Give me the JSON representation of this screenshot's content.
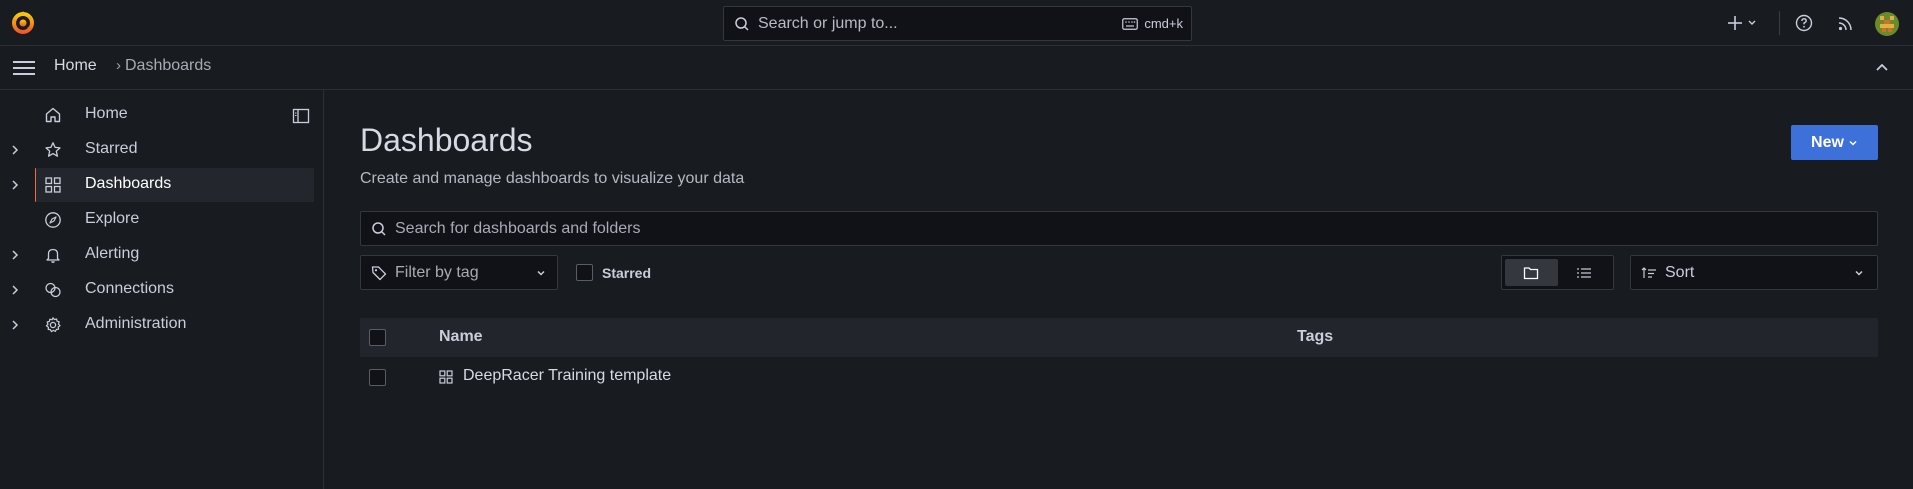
{
  "topbar": {
    "search_placeholder": "Search or jump to...",
    "shortcut": "cmd+k"
  },
  "breadcrumb": {
    "home": "Home",
    "separator": "›",
    "current": "Dashboards"
  },
  "sidebar": {
    "items": [
      {
        "label": "Home",
        "icon": "home-icon",
        "expandable": false,
        "active": false
      },
      {
        "label": "Starred",
        "icon": "star-icon",
        "expandable": true,
        "active": false
      },
      {
        "label": "Dashboards",
        "icon": "apps-icon",
        "expandable": true,
        "active": true
      },
      {
        "label": "Explore",
        "icon": "compass-icon",
        "expandable": false,
        "active": false
      },
      {
        "label": "Alerting",
        "icon": "bell-icon",
        "expandable": true,
        "active": false
      },
      {
        "label": "Connections",
        "icon": "link-icon",
        "expandable": true,
        "active": false
      },
      {
        "label": "Administration",
        "icon": "cog-icon",
        "expandable": true,
        "active": false
      }
    ]
  },
  "page": {
    "title": "Dashboards",
    "subtitle": "Create and manage dashboards to visualize your data",
    "new_button": "New",
    "search_placeholder": "Search for dashboards and folders",
    "filter_tag_placeholder": "Filter by tag",
    "starred_label": "Starred",
    "sort_label": "Sort"
  },
  "table": {
    "headers": {
      "name": "Name",
      "tags": "Tags"
    },
    "rows": [
      {
        "name": "DeepRacer Training template",
        "tags": ""
      }
    ]
  },
  "colors": {
    "background": "#181b1f",
    "accent": "#f06e35",
    "primary_button": "#3d71d9"
  }
}
